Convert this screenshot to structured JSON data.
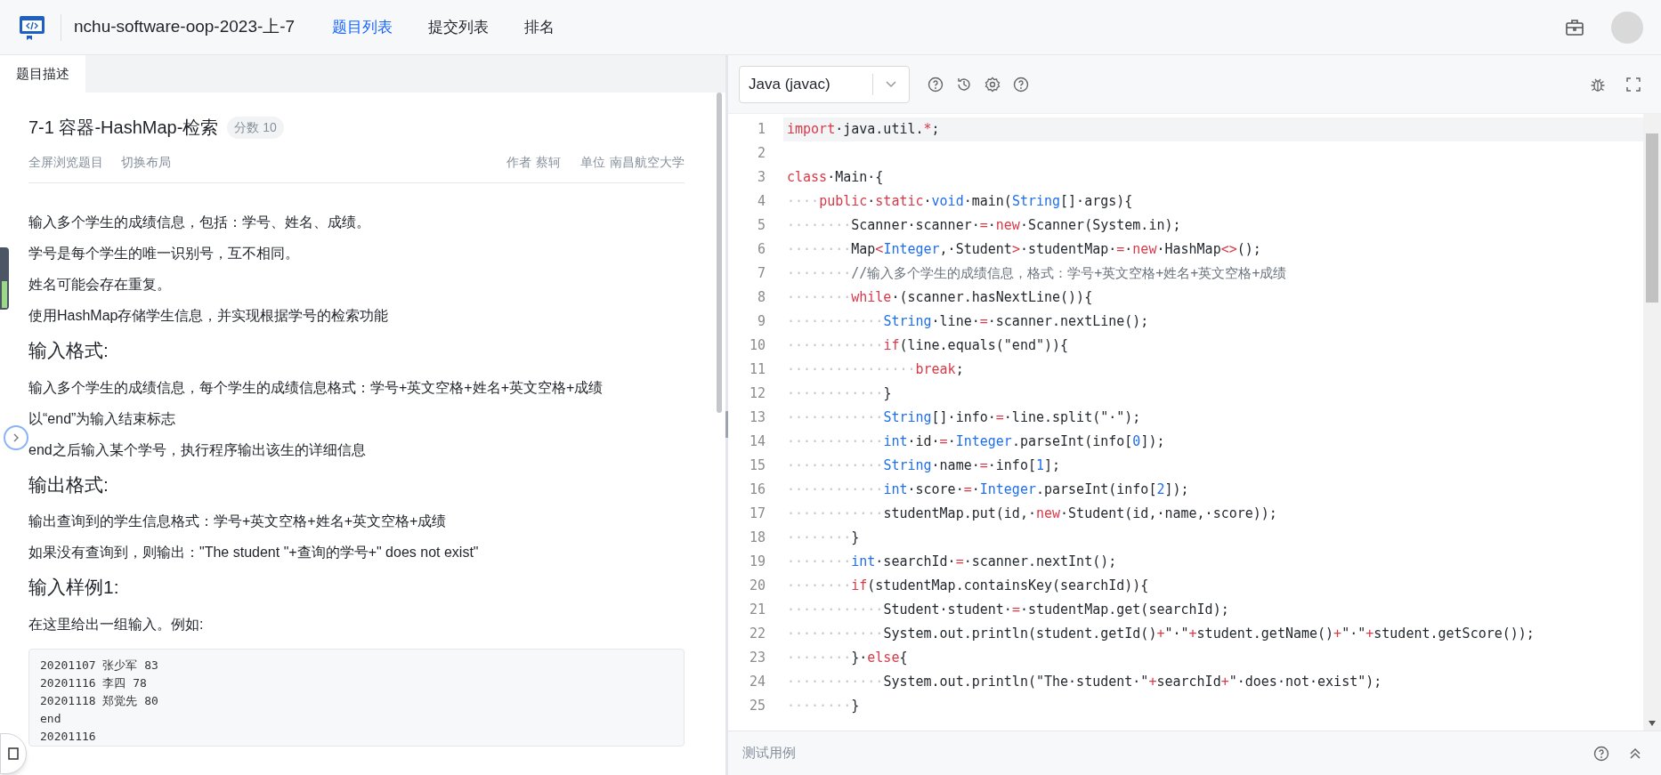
{
  "header": {
    "title": "nchu-software-oop-2023-上-7",
    "nav": [
      {
        "label": "题目列表",
        "selected": true
      },
      {
        "label": "提交列表",
        "selected": false
      },
      {
        "label": "排名",
        "selected": false
      }
    ]
  },
  "problem_tabs": [
    {
      "label": "题目描述",
      "selected": true
    }
  ],
  "problem": {
    "title": "7-1 容器-HashMap-检索",
    "score": "分数 10",
    "actions": [
      "全屏浏览题目",
      "切换布局"
    ],
    "meta": [
      {
        "label": "作者",
        "value": "蔡轲"
      },
      {
        "label": "单位",
        "value": "南昌航空大学"
      }
    ],
    "content": [
      {
        "kind": "p",
        "text": "输入多个学生的成绩信息，包括：学号、姓名、成绩。"
      },
      {
        "kind": "p",
        "text": "学号是每个学生的唯一识别号，互不相同。"
      },
      {
        "kind": "p",
        "text": "姓名可能会存在重复。"
      },
      {
        "kind": "p",
        "text": "使用HashMap存储学生信息，并实现根据学号的检索功能"
      },
      {
        "kind": "h",
        "text": "输入格式:"
      },
      {
        "kind": "p",
        "text": "输入多个学生的成绩信息，每个学生的成绩信息格式：学号+英文空格+姓名+英文空格+成绩"
      },
      {
        "kind": "p",
        "text": "以“end”为输入结束标志"
      },
      {
        "kind": "p",
        "text": "end之后输入某个学号，执行程序输出该生的详细信息"
      },
      {
        "kind": "h",
        "text": "输出格式:"
      },
      {
        "kind": "p",
        "text": "输出查询到的学生信息格式：学号+英文空格+姓名+英文空格+成绩"
      },
      {
        "kind": "p",
        "text": "如果没有查询到，则输出：\"The student \"+查询的学号+\" does not exist\""
      },
      {
        "kind": "h",
        "text": "输入样例1:"
      },
      {
        "kind": "p",
        "text": "在这里给出一组输入。例如:"
      },
      {
        "kind": "pre",
        "lines": [
          "20201107 张少军 83",
          "20201116 李四 78",
          "20201118 郑觉先 80",
          "end",
          "20201116"
        ]
      }
    ]
  },
  "editor": {
    "language": "Java (javac)",
    "lines": [
      {
        "number": "1",
        "active": true,
        "tokens": [
          {
            "kind": "kw",
            "text": "import"
          },
          {
            "kind": "p",
            "text": "·java.util."
          },
          {
            "kind": "kw",
            "text": "*"
          },
          {
            "kind": "p",
            "text": ";"
          }
        ]
      },
      {
        "number": "2",
        "active": false
      },
      {
        "number": "3",
        "active": false,
        "tokens": [
          {
            "kind": "kw",
            "text": "class"
          },
          {
            "kind": "p",
            "text": "·Main·{"
          }
        ]
      },
      {
        "number": "4",
        "active": false,
        "tokens": [
          {
            "kind": "ws",
            "text": "····"
          },
          {
            "kind": "kw",
            "text": "public"
          },
          {
            "kind": "p",
            "text": "·"
          },
          {
            "kind": "kw",
            "text": "static"
          },
          {
            "kind": "p",
            "text": "·"
          },
          {
            "kind": "ty",
            "text": "void"
          },
          {
            "kind": "p",
            "text": "·main("
          },
          {
            "kind": "ty",
            "text": "String"
          },
          {
            "kind": "p",
            "text": "[]·args){"
          }
        ]
      },
      {
        "number": "5",
        "active": false,
        "tokens": [
          {
            "kind": "ws",
            "text": "········"
          },
          {
            "kind": "p",
            "text": "Scanner·scanner·"
          },
          {
            "kind": "kw",
            "text": "="
          },
          {
            "kind": "p",
            "text": "·"
          },
          {
            "kind": "kw",
            "text": "new"
          },
          {
            "kind": "p",
            "text": "·Scanner(System.in);"
          }
        ]
      },
      {
        "number": "6",
        "active": false,
        "tokens": [
          {
            "kind": "ws",
            "text": "········"
          },
          {
            "kind": "p",
            "text": "Map"
          },
          {
            "kind": "kw",
            "text": "<"
          },
          {
            "kind": "ty",
            "text": "Integer"
          },
          {
            "kind": "p",
            "text": ",·Student"
          },
          {
            "kind": "kw",
            "text": ">"
          },
          {
            "kind": "p",
            "text": "·studentMap·"
          },
          {
            "kind": "kw",
            "text": "="
          },
          {
            "kind": "p",
            "text": "·"
          },
          {
            "kind": "kw",
            "text": "new"
          },
          {
            "kind": "p",
            "text": "·HashMap"
          },
          {
            "kind": "kw",
            "text": "<>"
          },
          {
            "kind": "p",
            "text": "();"
          }
        ]
      },
      {
        "number": "7",
        "active": false,
        "tokens": [
          {
            "kind": "ws",
            "text": "········"
          },
          {
            "kind": "cm",
            "text": "//输入多个学生的成绩信息，格式：学号+英文空格+姓名+英文空格+成绩"
          }
        ]
      },
      {
        "number": "8",
        "active": false,
        "tokens": [
          {
            "kind": "ws",
            "text": "········"
          },
          {
            "kind": "kw",
            "text": "while"
          },
          {
            "kind": "p",
            "text": "·(scanner.hasNextLine()){"
          }
        ]
      },
      {
        "number": "9",
        "active": false,
        "tokens": [
          {
            "kind": "ws",
            "text": "············"
          },
          {
            "kind": "ty",
            "text": "String"
          },
          {
            "kind": "p",
            "text": "·line·"
          },
          {
            "kind": "kw",
            "text": "="
          },
          {
            "kind": "p",
            "text": "·scanner.nextLine();"
          }
        ]
      },
      {
        "number": "10",
        "active": false,
        "tokens": [
          {
            "kind": "ws",
            "text": "············"
          },
          {
            "kind": "kw",
            "text": "if"
          },
          {
            "kind": "p",
            "text": "(line.equals(\"end\")){"
          }
        ]
      },
      {
        "number": "11",
        "active": false,
        "tokens": [
          {
            "kind": "ws",
            "text": "················"
          },
          {
            "kind": "kw",
            "text": "break"
          },
          {
            "kind": "p",
            "text": ";"
          }
        ]
      },
      {
        "number": "12",
        "active": false,
        "tokens": [
          {
            "kind": "ws",
            "text": "············"
          },
          {
            "kind": "p",
            "text": "}"
          }
        ]
      },
      {
        "number": "13",
        "active": false,
        "tokens": [
          {
            "kind": "ws",
            "text": "············"
          },
          {
            "kind": "ty",
            "text": "String"
          },
          {
            "kind": "p",
            "text": "[]·info·"
          },
          {
            "kind": "kw",
            "text": "="
          },
          {
            "kind": "p",
            "text": "·line.split(\"·\");"
          }
        ]
      },
      {
        "number": "14",
        "active": false,
        "tokens": [
          {
            "kind": "ws",
            "text": "············"
          },
          {
            "kind": "ty",
            "text": "int"
          },
          {
            "kind": "p",
            "text": "·id·"
          },
          {
            "kind": "kw",
            "text": "="
          },
          {
            "kind": "p",
            "text": "·"
          },
          {
            "kind": "ty",
            "text": "Integer"
          },
          {
            "kind": "p",
            "text": ".parseInt(info["
          },
          {
            "kind": "ty",
            "text": "0"
          },
          {
            "kind": "p",
            "text": "]);"
          }
        ]
      },
      {
        "number": "15",
        "active": false,
        "tokens": [
          {
            "kind": "ws",
            "text": "············"
          },
          {
            "kind": "ty",
            "text": "String"
          },
          {
            "kind": "p",
            "text": "·name·"
          },
          {
            "kind": "kw",
            "text": "="
          },
          {
            "kind": "p",
            "text": "·info["
          },
          {
            "kind": "ty",
            "text": "1"
          },
          {
            "kind": "p",
            "text": "];"
          }
        ]
      },
      {
        "number": "16",
        "active": false,
        "tokens": [
          {
            "kind": "ws",
            "text": "············"
          },
          {
            "kind": "ty",
            "text": "int"
          },
          {
            "kind": "p",
            "text": "·score·"
          },
          {
            "kind": "kw",
            "text": "="
          },
          {
            "kind": "p",
            "text": "·"
          },
          {
            "kind": "ty",
            "text": "Integer"
          },
          {
            "kind": "p",
            "text": ".parseInt(info["
          },
          {
            "kind": "ty",
            "text": "2"
          },
          {
            "kind": "p",
            "text": "]);"
          }
        ]
      },
      {
        "number": "17",
        "active": false,
        "tokens": [
          {
            "kind": "ws",
            "text": "············"
          },
          {
            "kind": "p",
            "text": "studentMap.put(id,·"
          },
          {
            "kind": "kw",
            "text": "new"
          },
          {
            "kind": "p",
            "text": "·Student(id,·name,·score));"
          }
        ]
      },
      {
        "number": "18",
        "active": false,
        "tokens": [
          {
            "kind": "ws",
            "text": "········"
          },
          {
            "kind": "p",
            "text": "}"
          }
        ]
      },
      {
        "number": "19",
        "active": false,
        "tokens": [
          {
            "kind": "ws",
            "text": "········"
          },
          {
            "kind": "ty",
            "text": "int"
          },
          {
            "kind": "p",
            "text": "·searchId·"
          },
          {
            "kind": "kw",
            "text": "="
          },
          {
            "kind": "p",
            "text": "·scanner.nextInt();"
          }
        ]
      },
      {
        "number": "20",
        "active": false,
        "tokens": [
          {
            "kind": "ws",
            "text": "········"
          },
          {
            "kind": "kw",
            "text": "if"
          },
          {
            "kind": "p",
            "text": "(studentMap.containsKey(searchId)){"
          }
        ]
      },
      {
        "number": "21",
        "active": false,
        "tokens": [
          {
            "kind": "ws",
            "text": "············"
          },
          {
            "kind": "p",
            "text": "Student·student·"
          },
          {
            "kind": "kw",
            "text": "="
          },
          {
            "kind": "p",
            "text": "·studentMap.get(searchId);"
          }
        ]
      },
      {
        "number": "22",
        "active": false,
        "tokens": [
          {
            "kind": "ws",
            "text": "············"
          },
          {
            "kind": "p",
            "text": "System.out.println(student.getId()"
          },
          {
            "kind": "kw",
            "text": "+"
          },
          {
            "kind": "p",
            "text": "\"·\""
          },
          {
            "kind": "kw",
            "text": "+"
          },
          {
            "kind": "p",
            "text": "student.getName()"
          },
          {
            "kind": "kw",
            "text": "+"
          },
          {
            "kind": "p",
            "text": "\"·\""
          },
          {
            "kind": "kw",
            "text": "+"
          },
          {
            "kind": "p",
            "text": "student.getScore());"
          }
        ]
      },
      {
        "number": "23",
        "active": false,
        "tokens": [
          {
            "kind": "ws",
            "text": "········"
          },
          {
            "kind": "p",
            "text": "}·"
          },
          {
            "kind": "kw",
            "text": "else"
          },
          {
            "kind": "p",
            "text": "{"
          }
        ]
      },
      {
        "number": "24",
        "active": false,
        "tokens": [
          {
            "kind": "ws",
            "text": "············"
          },
          {
            "kind": "p",
            "text": "System.out.println(\"The·student·\""
          },
          {
            "kind": "kw",
            "text": "+"
          },
          {
            "kind": "p",
            "text": "searchId"
          },
          {
            "kind": "kw",
            "text": "+"
          },
          {
            "kind": "p",
            "text": "\"·does·not·exist\");"
          }
        ]
      },
      {
        "number": "25",
        "active": false,
        "tokens": [
          {
            "kind": "ws",
            "text": "········"
          },
          {
            "kind": "p",
            "text": "}"
          }
        ]
      }
    ]
  },
  "bottom_bar": {
    "label": "测试用例"
  }
}
